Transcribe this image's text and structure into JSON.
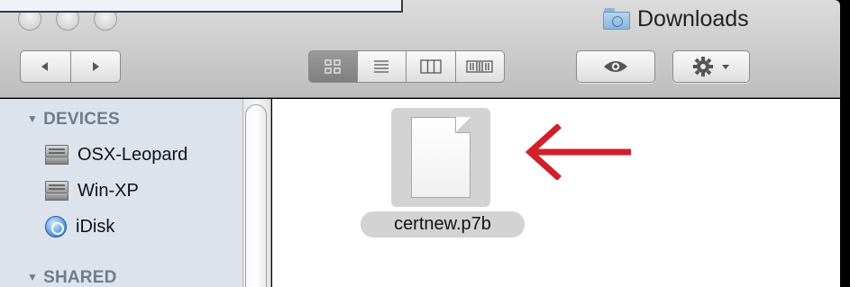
{
  "window": {
    "title": "Downloads"
  },
  "toolbar": {
    "back_icon": "back-arrow-icon",
    "forward_icon": "forward-arrow-icon",
    "view_modes": [
      "icon-view",
      "list-view",
      "column-view",
      "cover-flow-view"
    ],
    "active_view": "icon-view",
    "quicklook_icon": "eye-icon",
    "action_icon": "gear-icon"
  },
  "sidebar": {
    "sections": [
      {
        "title": "DEVICES",
        "items": [
          {
            "label": "OSX-Leopard",
            "icon": "hard-drive-icon"
          },
          {
            "label": "Win-XP",
            "icon": "hard-drive-icon"
          },
          {
            "label": "iDisk",
            "icon": "idisk-icon"
          }
        ]
      },
      {
        "title": "SHARED",
        "items": []
      }
    ]
  },
  "content": {
    "files": [
      {
        "name": "certnew.p7b",
        "icon": "document-icon",
        "selected": true
      }
    ]
  },
  "annotation": {
    "color": "#d0202a",
    "icon": "left-arrow-annotation"
  }
}
